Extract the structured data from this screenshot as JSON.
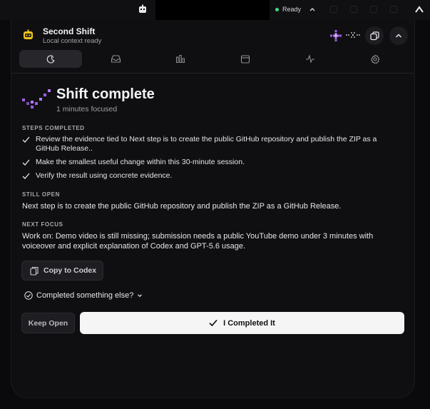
{
  "menubar": {
    "status_text": "Ready",
    "status_color": "#3ddc84",
    "icons": [
      "app-robot-icon",
      "chevron-up-icon",
      "menubar-arrow-icon"
    ]
  },
  "header": {
    "title": "Second Shift",
    "subtitle": "Local context ready",
    "accent_color": "#9b5de5",
    "icons": [
      "robot-mascot-icon",
      "sparkle-plus-icon",
      "pixel-dots-icon",
      "copy-windows-icon",
      "chevron-up-icon"
    ]
  },
  "tabs": [
    {
      "icon": "moon-icon",
      "active": true
    },
    {
      "icon": "inbox-icon",
      "active": false
    },
    {
      "icon": "bar-chart-icon",
      "active": false
    },
    {
      "icon": "calendar-icon",
      "active": false
    },
    {
      "icon": "activity-icon",
      "active": false
    },
    {
      "icon": "gear-icon",
      "active": false
    }
  ],
  "summary": {
    "title": "Shift complete",
    "focused_text": "1 minutes focused"
  },
  "steps_completed": {
    "label": "STEPS COMPLETED",
    "items": [
      {
        "text": "Review the evidence tied to Next step is to create the public GitHub repository and publish the ZIP as a GitHub Release.."
      },
      {
        "text": "Make the smallest useful change within this 30-minute session."
      },
      {
        "text": "Verify the result using concrete evidence."
      }
    ]
  },
  "still_open": {
    "label": "STILL OPEN",
    "text": "Next step is to create the public GitHub repository and publish the ZIP as a GitHub Release."
  },
  "next_focus": {
    "label": "NEXT FOCUS",
    "text": "Work on: Demo video is still missing; submission needs a public YouTube demo under 3 minutes with voiceover and explicit explanation of Codex and GPT-5.6 usage."
  },
  "actions": {
    "copy_to_codex": "Copy to Codex",
    "completed_something_else": "Completed something else?",
    "keep_open": "Keep Open",
    "i_completed_it": "I Completed It"
  }
}
